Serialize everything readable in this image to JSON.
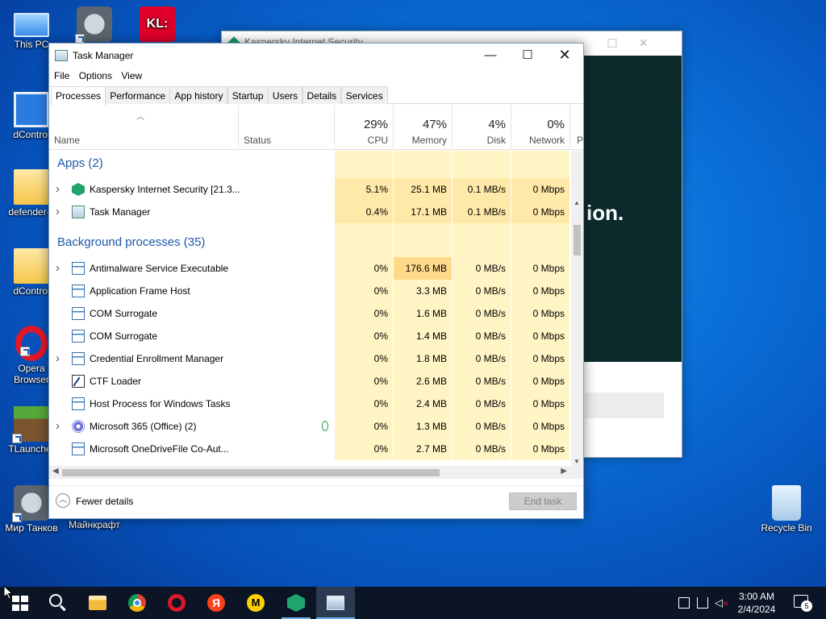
{
  "desktop": {
    "icons": [
      {
        "label": "This PC"
      },
      {
        "label": "dControl"
      },
      {
        "label": "defender-c"
      },
      {
        "label": "dControl"
      },
      {
        "label": "Opera Browser"
      },
      {
        "label": "TLauncher"
      },
      {
        "label": "Мир Танков"
      },
      {
        "label": "Майнкрафт"
      },
      {
        "label": "Recycle Bin"
      },
      {
        "label": "KL:"
      }
    ]
  },
  "bg_window": {
    "title": "Kaspersky Internet Security",
    "headline": "ion."
  },
  "task_manager": {
    "title": "Task Manager",
    "menu": [
      "File",
      "Options",
      "View"
    ],
    "tabs": [
      "Processes",
      "Performance",
      "App history",
      "Startup",
      "Users",
      "Details",
      "Services"
    ],
    "active_tab": "Processes",
    "columns": {
      "name": "Name",
      "status": "Status",
      "cpu": {
        "pct": "29%",
        "label": "CPU"
      },
      "memory": {
        "pct": "47%",
        "label": "Memory"
      },
      "disk": {
        "pct": "4%",
        "label": "Disk"
      },
      "network": {
        "pct": "0%",
        "label": "Network"
      },
      "power_partial": "P"
    },
    "groups": {
      "apps": "Apps (2)",
      "background": "Background processes (35)"
    },
    "apps": [
      {
        "name": "Kaspersky Internet Security [21.3...",
        "icon": "kaspersky-icon",
        "expand": true,
        "cpu": "5.1%",
        "memory": "25.1 MB",
        "disk": "0.1 MB/s",
        "network": "0 Mbps"
      },
      {
        "name": "Task Manager",
        "icon": "task-manager-icon",
        "expand": true,
        "cpu": "0.4%",
        "memory": "17.1 MB",
        "disk": "0.1 MB/s",
        "network": "0 Mbps"
      }
    ],
    "background": [
      {
        "name": "Antimalware Service Executable",
        "icon": "window-icon",
        "expand": true,
        "cpu": "0%",
        "memory": "176.6 MB",
        "disk": "0 MB/s",
        "network": "0 Mbps"
      },
      {
        "name": "Application Frame Host",
        "icon": "window-icon",
        "expand": false,
        "cpu": "0%",
        "memory": "3.3 MB",
        "disk": "0 MB/s",
        "network": "0 Mbps"
      },
      {
        "name": "COM Surrogate",
        "icon": "window-icon",
        "expand": false,
        "cpu": "0%",
        "memory": "1.6 MB",
        "disk": "0 MB/s",
        "network": "0 Mbps"
      },
      {
        "name": "COM Surrogate",
        "icon": "window-icon",
        "expand": false,
        "cpu": "0%",
        "memory": "1.4 MB",
        "disk": "0 MB/s",
        "network": "0 Mbps"
      },
      {
        "name": "Credential Enrollment Manager",
        "icon": "window-icon",
        "expand": true,
        "cpu": "0%",
        "memory": "1.8 MB",
        "disk": "0 MB/s",
        "network": "0 Mbps"
      },
      {
        "name": "CTF Loader",
        "icon": "ctf-loader-icon",
        "expand": false,
        "cpu": "0%",
        "memory": "2.6 MB",
        "disk": "0 MB/s",
        "network": "0 Mbps"
      },
      {
        "name": "Host Process for Windows Tasks",
        "icon": "window-icon",
        "expand": false,
        "cpu": "0%",
        "memory": "2.4 MB",
        "disk": "0 MB/s",
        "network": "0 Mbps"
      },
      {
        "name": "Microsoft 365 (Office) (2)",
        "icon": "microsoft-365-icon",
        "expand": true,
        "leaf": true,
        "cpu": "0%",
        "memory": "1.3 MB",
        "disk": "0 MB/s",
        "network": "0 Mbps"
      },
      {
        "name": "Microsoft OneDriveFile Co-Aut...",
        "icon": "window-icon",
        "expand": false,
        "cpu": "0%",
        "memory": "2.7 MB",
        "disk": "0 MB/s",
        "network": "0 Mbps"
      }
    ],
    "footer": {
      "fewer_details": "Fewer details",
      "end_task": "End task"
    }
  },
  "taskbar": {
    "apps": [
      "start",
      "search",
      "file-explorer",
      "chrome",
      "opera",
      "yandex",
      "yandex-market",
      "kaspersky",
      "task-manager"
    ],
    "yandex_letter": "Я",
    "ymarket_letter": "M",
    "clock_time": "3:00 AM",
    "clock_date": "2/4/2024",
    "notification_count": "5"
  },
  "colors": {
    "group_label": "#1a58a8",
    "heat_light": "#fff4c4",
    "heat_mid": "#ffe9a8",
    "heat_strong": "#ffd98a",
    "taskbar": "#0b1526"
  }
}
